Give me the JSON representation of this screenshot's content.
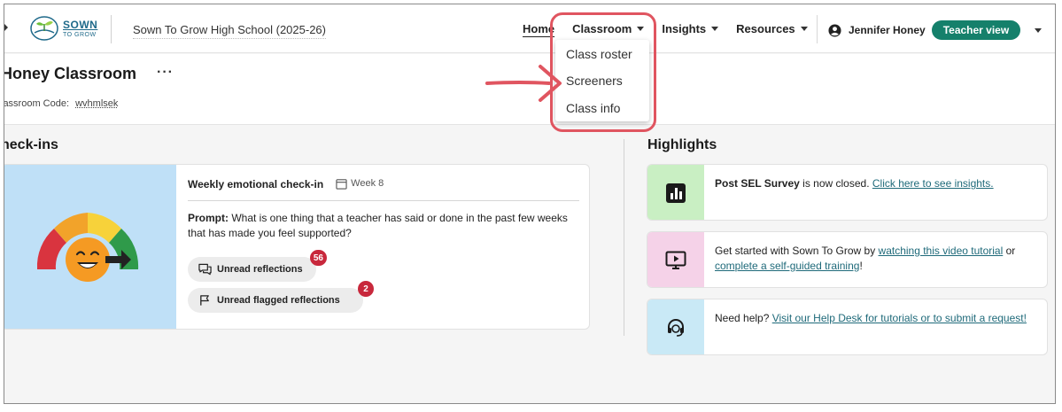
{
  "header": {
    "logo": {
      "top": "SOWN",
      "bottom": "TO GROW"
    },
    "school_name": "Sown To Grow High School (2025-26)",
    "nav": [
      {
        "label": "Home",
        "active": true
      },
      {
        "label": "Classroom",
        "dropdown": true
      },
      {
        "label": "Insights",
        "dropdown": true
      },
      {
        "label": "Resources",
        "dropdown": true
      }
    ],
    "user_name": "Jennifer Honey",
    "view_label": "Teacher view"
  },
  "classroom_menu": {
    "items": [
      "Class roster",
      "Screeners",
      "Class info"
    ]
  },
  "class_header": {
    "title": "Honey Classroom",
    "more": "···",
    "code_label": "lassroom Code:",
    "code_value": "wvhmlsek"
  },
  "checkins": {
    "title": "heck-ins",
    "card": {
      "title": "Weekly emotional check-in",
      "week": "Week 8",
      "prompt_label": "Prompt:",
      "prompt_text": "What is one thing that a teacher has said or done in the past few weeks that has made you feel supported?",
      "unread_reflections_label": "Unread reflections",
      "unread_reflections_count": "56",
      "unread_flagged_label": "Unread flagged reflections",
      "unread_flagged_count": "2"
    }
  },
  "highlights": {
    "title": "Highlights",
    "items": [
      {
        "icon": "chart-icon",
        "bold": "Post SEL Survey",
        "text": " is now closed. ",
        "link": "Click here to see insights."
      },
      {
        "icon": "video-play-icon",
        "text": "Get started with Sown To Grow by ",
        "link": "watching this video tutorial",
        "text2": " or ",
        "link2": "complete a self-guided training",
        "text3": "!"
      },
      {
        "icon": "headset-icon",
        "text": "Need help? ",
        "link": "Visit our Help Desk for tutorials or to submit a request!"
      }
    ]
  },
  "colors": {
    "accent": "#15806b",
    "badge": "#c8283c",
    "annotation": "#e05560",
    "link": "#1f6a7a"
  }
}
